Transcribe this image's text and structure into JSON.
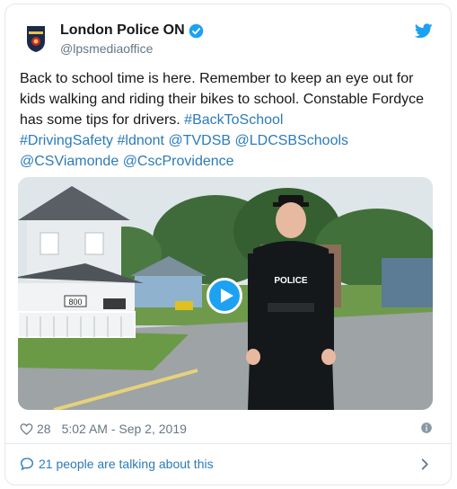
{
  "account": {
    "display_name": "London Police ON",
    "handle": "@lpsmediaoffice"
  },
  "tweet": {
    "text_parts": [
      "Back to school time is here. Remember to keep an eye out for kids walking and riding their bikes to school. Constable Fordyce has some tips for drivers. ",
      "#BackToSchool",
      " ",
      "#DrivingSafety",
      " ",
      "#ldnont",
      " ",
      "@TVDSB",
      " ",
      "@LDCSBSchools",
      " ",
      "@CSViamonde",
      " ",
      "@CscProvidence"
    ]
  },
  "media": {
    "badge_text": "POLICE",
    "house_number": "800"
  },
  "meta": {
    "likes": "28",
    "timestamp": "5:02 AM - Sep 2, 2019"
  },
  "footer": {
    "talking_label": "21 people are talking about this"
  },
  "icons": [
    "police-crest-icon",
    "verified-icon",
    "twitter-bird-icon",
    "play-icon",
    "heart-icon",
    "info-icon",
    "speech-bubble-icon",
    "chevron-right-icon"
  ],
  "colors": {
    "link": "#2b7bb9",
    "twitter_blue": "#1da1f2",
    "muted": "#657786",
    "border": "#e1e8ed"
  }
}
